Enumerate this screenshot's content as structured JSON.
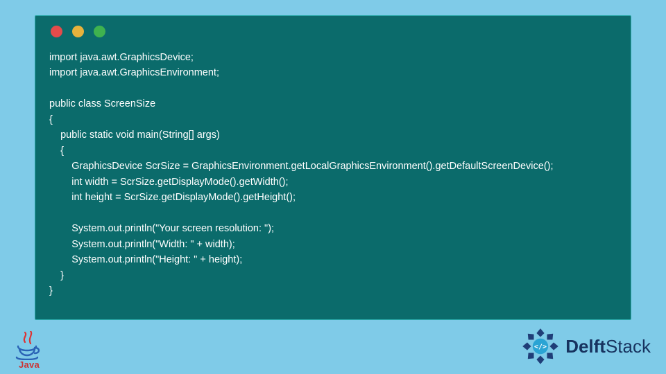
{
  "code": {
    "lines": [
      "import java.awt.GraphicsDevice;",
      "import java.awt.GraphicsEnvironment;",
      "",
      "public class ScreenSize",
      "{",
      "    public static void main(String[] args)",
      "    {",
      "        GraphicsDevice ScrSize = GraphicsEnvironment.getLocalGraphicsEnvironment().getDefaultScreenDevice();",
      "        int width = ScrSize.getDisplayMode().getWidth();",
      "        int height = ScrSize.getDisplayMode().getHeight();",
      "",
      "        System.out.println(\"Your screen resolution: \");",
      "        System.out.println(\"Width: \" + width);",
      "        System.out.println(\"Height: \" + height);",
      "    }",
      "}"
    ]
  },
  "window": {
    "colors": {
      "red": "#e44b4b",
      "yellow": "#e7b23c",
      "green": "#3fb24f",
      "bg": "#0b6b6b"
    }
  },
  "branding": {
    "java_label": "Java",
    "delft_prefix": "Delft",
    "delft_suffix": "Stack"
  }
}
